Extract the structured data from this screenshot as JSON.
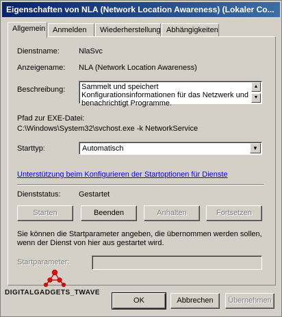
{
  "window": {
    "title": "Eigenschaften von NLA (Network Location Awareness) (Lokaler Co..."
  },
  "tabs": [
    {
      "label": "Allgemein",
      "active": true
    },
    {
      "label": "Anmelden",
      "active": false
    },
    {
      "label": "Wiederherstellung",
      "active": false
    },
    {
      "label": "Abhängigkeiten",
      "active": false
    }
  ],
  "general": {
    "service_name_label": "Dienstname:",
    "service_name": "NlaSvc",
    "display_name_label": "Anzeigename:",
    "display_name": "NLA (Network Location Awareness)",
    "description_label": "Beschreibung:",
    "description": "Sammelt und speichert Konfigurationsinformationen für das Netzwerk und benachrichtigt Programme.",
    "path_label": "Pfad zur EXE-Datei:",
    "path": "C:\\Windows\\System32\\svchost.exe -k NetworkService",
    "startup_type_label": "Starttyp:",
    "startup_type": "Automatisch",
    "help_link": "Unterstützung beim Konfigurieren der Startoptionen für Dienste",
    "status_label": "Dienststatus:",
    "status": "Gestartet",
    "hint": "Sie können die Startparameter angeben, die übernommen werden sollen, wenn der Dienst von hier aus gestartet wird.",
    "start_params_label": "Startparameter:",
    "start_params_value": ""
  },
  "service_buttons": {
    "start": "Starten",
    "stop": "Beenden",
    "pause": "Anhalten",
    "resume": "Fortsetzen"
  },
  "footer_buttons": {
    "ok": "OK",
    "cancel": "Abbrechen",
    "apply": "Übernehmen"
  },
  "watermark": {
    "text": "DIGITALGADGETS_TWAVE",
    "colors": {
      "logo": "#cc1111"
    }
  },
  "icons": {
    "scroll_up": "scroll-up-icon",
    "scroll_down": "scroll-down-icon",
    "dropdown": "chevron-down-icon"
  }
}
